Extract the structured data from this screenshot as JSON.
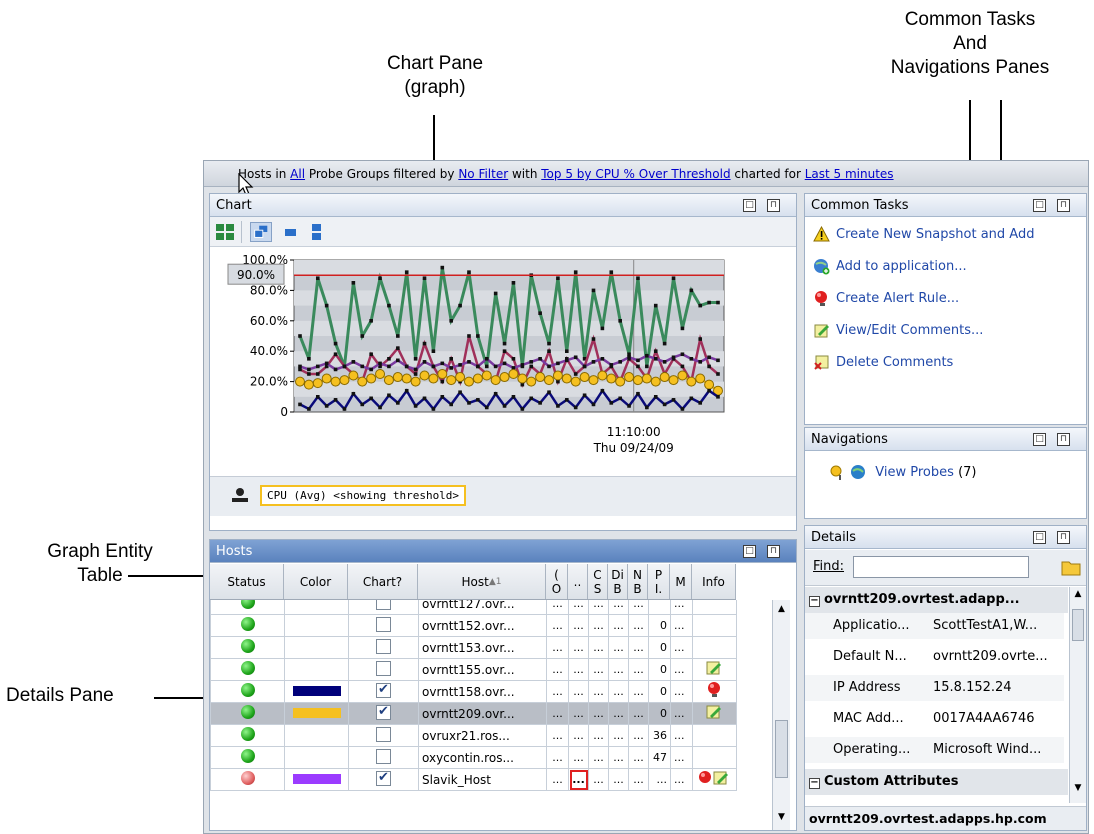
{
  "annotations": {
    "chart_pane": [
      "Chart Pane",
      "(graph)"
    ],
    "common_tasks": [
      "Common Tasks",
      "And",
      "Navigations Panes"
    ],
    "graph_entity": [
      "Graph Entity",
      "Table"
    ],
    "details_pane": "Details Pane"
  },
  "topbar": {
    "t1": "Hosts in ",
    "all": "All",
    "t2": " Probe Groups filtered by ",
    "nofilter": "No Filter",
    "t3": " with ",
    "top5": "Top 5 by CPU % Over Threshold",
    "t4": " charted for ",
    "last5": "Last 5 minutes"
  },
  "chart_pane": {
    "title": "Chart",
    "legend": "CPU (Avg) <showing threshold>",
    "threshold_label": "90.0%",
    "x_label_time": "11:10:00",
    "x_label_date": "Thu 09/24/09"
  },
  "chart_data": {
    "type": "line",
    "ylim": [
      0,
      100
    ],
    "yticks": [
      "100.0%",
      "80.0%",
      "60.0%",
      "40.0%",
      "20.0%",
      "0"
    ],
    "threshold": 90,
    "series": [
      {
        "color": "#3a8a5c",
        "values": [
          50,
          35,
          88,
          70,
          45,
          30,
          85,
          50,
          60,
          88,
          70,
          50,
          92,
          35,
          88,
          40,
          95,
          60,
          70,
          92,
          50,
          30,
          78,
          45,
          85,
          30,
          90,
          65,
          45,
          88,
          40,
          92,
          35,
          80,
          55,
          92,
          60,
          38,
          88,
          30,
          70,
          45,
          88,
          55,
          80,
          70,
          72,
          72
        ]
      },
      {
        "color": "#a0305a",
        "values": [
          28,
          25,
          25,
          30,
          38,
          30,
          25,
          20,
          38,
          30,
          35,
          42,
          30,
          25,
          45,
          30,
          20,
          35,
          20,
          50,
          30,
          25,
          20,
          40,
          35,
          18,
          30,
          25,
          40,
          20,
          35,
          25,
          30,
          48,
          25,
          30,
          20,
          35,
          30,
          22,
          40,
          25,
          35,
          30,
          20,
          48,
          30,
          25
        ]
      },
      {
        "color": "#7a3aa0",
        "values": [
          30,
          28,
          30,
          32,
          28,
          30,
          33,
          30,
          28,
          32,
          30,
          34,
          30,
          28,
          33,
          30,
          32,
          29,
          31,
          33,
          30,
          35,
          30,
          32,
          29,
          31,
          33,
          35,
          30,
          32,
          34,
          36,
          30,
          33,
          35,
          31,
          33,
          36,
          34,
          37,
          35,
          33,
          36,
          38,
          35,
          33,
          36,
          34
        ]
      },
      {
        "color": "#e8b820",
        "values": [
          20,
          18,
          19,
          22,
          20,
          21,
          24,
          20,
          22,
          25,
          21,
          23,
          22,
          20,
          24,
          22,
          25,
          21,
          23,
          20,
          22,
          24,
          21,
          23,
          25,
          22,
          20,
          23,
          21,
          24,
          22,
          20,
          23,
          21,
          24,
          22,
          20,
          23,
          21,
          22,
          20,
          23,
          21,
          24,
          20,
          22,
          18,
          14
        ]
      },
      {
        "color": "#0a0a7a",
        "values": [
          5,
          2,
          10,
          4,
          8,
          2,
          12,
          5,
          9,
          3,
          11,
          6,
          14,
          4,
          9,
          2,
          10,
          5,
          13,
          6,
          8,
          3,
          12,
          4,
          10,
          2,
          9,
          6,
          13,
          4,
          8,
          3,
          11,
          5,
          14,
          6,
          9,
          4,
          12,
          3,
          10,
          5,
          8,
          2,
          9,
          6,
          14,
          10
        ]
      }
    ]
  },
  "hosts_pane": {
    "title": "Hosts",
    "columns": [
      "Status",
      "Color",
      "Chart?",
      "Host",
      "(",
      "..",
      "C",
      "Di",
      "N",
      "P",
      "M",
      "Info"
    ],
    "columns2": [
      "",
      "",
      "",
      "",
      "O",
      "",
      "S",
      "B",
      "B",
      "I.",
      "",
      ""
    ],
    "rows": [
      {
        "host": "ovrntt127.ovr...",
        "chart": false,
        "color": "",
        "status": "green",
        "p": "",
        "info": "",
        "row_bg": "#ffffff"
      },
      {
        "host": "ovrntt152.ovr...",
        "chart": false,
        "color": "",
        "status": "green",
        "p": "0",
        "info": "",
        "row_bg": "#ffffff"
      },
      {
        "host": "ovrntt153.ovr...",
        "chart": false,
        "color": "",
        "status": "green",
        "p": "0",
        "info": "",
        "row_bg": "#ffffff"
      },
      {
        "host": "ovrntt155.ovr...",
        "chart": false,
        "color": "",
        "status": "green",
        "p": "0",
        "info": "note",
        "row_bg": "#ffffff"
      },
      {
        "host": "ovrntt158.ovr...",
        "chart": true,
        "color": "#00007a",
        "status": "green",
        "p": "0",
        "info": "alert",
        "row_bg": "#ffffff"
      },
      {
        "host": "ovrntt209.ovr...",
        "chart": true,
        "color": "#f5c020",
        "status": "green",
        "p": "0",
        "info": "note",
        "row_bg": "#b9bec6"
      },
      {
        "host": "ovruxr21.ros...",
        "chart": false,
        "color": "",
        "status": "green",
        "p": "36",
        "info": "",
        "row_bg": "#ffffff"
      },
      {
        "host": "oxycontin.ros...",
        "chart": false,
        "color": "",
        "status": "green",
        "p": "47",
        "info": "",
        "row_bg": "#ffffff"
      },
      {
        "host": "Slavik_Host",
        "chart": true,
        "color": "#9b3bff",
        "status": "red",
        "p": "...",
        "info": "alert-note",
        "row_bg": "#ffffff"
      }
    ],
    "ellipsis": "..."
  },
  "common_tasks": {
    "title": "Common Tasks",
    "items": [
      "Create New Snapshot and Add",
      "Add to application...",
      "Create Alert Rule...",
      "View/Edit Comments...",
      "Delete Comments"
    ]
  },
  "navigations": {
    "title": "Navigations",
    "view_probes": "View Probes",
    "count": "(7)"
  },
  "details": {
    "title": "Details",
    "find_label": "Find:",
    "group": "ovrntt209.ovrtest.adapp...",
    "rows": [
      {
        "k": "Applicatio...",
        "v": "ScottTestA1,W..."
      },
      {
        "k": "Default N...",
        "v": "ovrntt209.ovrte..."
      },
      {
        "k": "IP Address",
        "v": "15.8.152.24"
      },
      {
        "k": "MAC Add...",
        "v": "0017A4AA6746"
      },
      {
        "k": "Operating...",
        "v": "Microsoft Wind..."
      }
    ],
    "custom": "Custom Attributes",
    "footer": "ovrntt209.ovrtest.adapps.hp.com"
  }
}
